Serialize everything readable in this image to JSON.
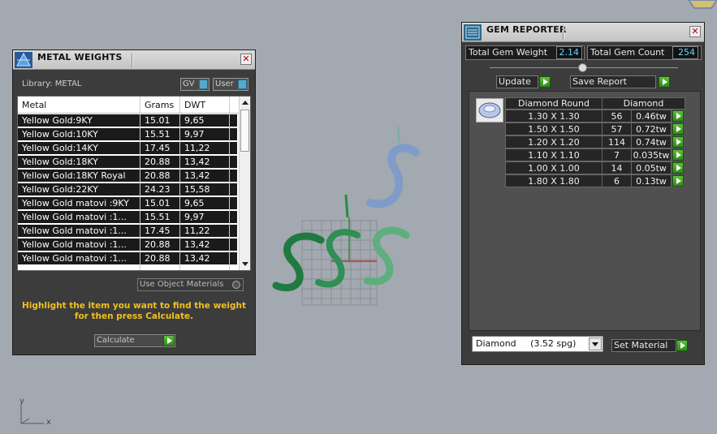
{
  "metal_weights": {
    "title": "METAL WEIGHTS",
    "library_label": "Library: METAL",
    "toggle_gv": "GV",
    "toggle_user": "User",
    "columns": [
      "Metal",
      "Grams",
      "DWT"
    ],
    "rows": [
      [
        "Yellow Gold:9KY",
        "15.01",
        "9,65"
      ],
      [
        "Yellow Gold:10KY",
        "15.51",
        "9,97"
      ],
      [
        "Yellow Gold:14KY",
        "17.45",
        "11,22"
      ],
      [
        "Yellow Gold:18KY",
        "20.88",
        "13,42"
      ],
      [
        "Yellow Gold:18KY Royal",
        "20.88",
        "13,42"
      ],
      [
        "Yellow Gold:22KY",
        "24.23",
        "15,58"
      ],
      [
        "Yellow Gold matovi :9KY",
        "15.01",
        "9,65"
      ],
      [
        "Yellow Gold matovi :1...",
        "15.51",
        "9,97"
      ],
      [
        "Yellow Gold matovi :1...",
        "17.45",
        "11,22"
      ],
      [
        "Yellow Gold matovi :1...",
        "20.88",
        "13,42"
      ],
      [
        "Yellow Gold matovi :1...",
        "20.88",
        "13,42"
      ]
    ],
    "use_object_materials": "Use Object Materials",
    "instruction_line1": "Highlight the item you want to find the weight",
    "instruction_line2": "for then press Calculate.",
    "calculate_label": "Calculate"
  },
  "gem_reporter": {
    "title": "GEM REPORTER",
    "total_gem_weight_label": "Total Gem Weight",
    "total_gem_weight_value": "2.14",
    "total_gem_count_label": "Total Gem Count",
    "total_gem_count_value": "254",
    "update_label": "Update",
    "save_report_label": "Save Report",
    "gem_shape": "Diamond Round",
    "gem_material": "Diamond",
    "gems": [
      {
        "size": "1.30 X 1.30",
        "count": "56",
        "weight": "0.46tw"
      },
      {
        "size": "1.50 X 1.50",
        "count": "57",
        "weight": "0.72tw"
      },
      {
        "size": "1.20 X 1.20",
        "count": "114",
        "weight": "0.74tw"
      },
      {
        "size": "1.10 X 1.10",
        "count": "7",
        "weight": "0.035tw"
      },
      {
        "size": "1.00 X 1.00",
        "count": "14",
        "weight": "0.05tw"
      },
      {
        "size": "1.80 X 1.80",
        "count": "6",
        "weight": "0.13tw"
      }
    ],
    "material_select": "Diamond     (3.52 spg)",
    "set_material_label": "Set Material"
  },
  "viewport": {
    "axis_y": "y",
    "axis_x": "x"
  },
  "colors": {
    "viewport_bg": "#a3a9b0",
    "panel_bg": "#3c3c3c",
    "accent_value": "#5fd8ff",
    "instruction_text": "#f0c020",
    "button_green": "#3fa828"
  }
}
